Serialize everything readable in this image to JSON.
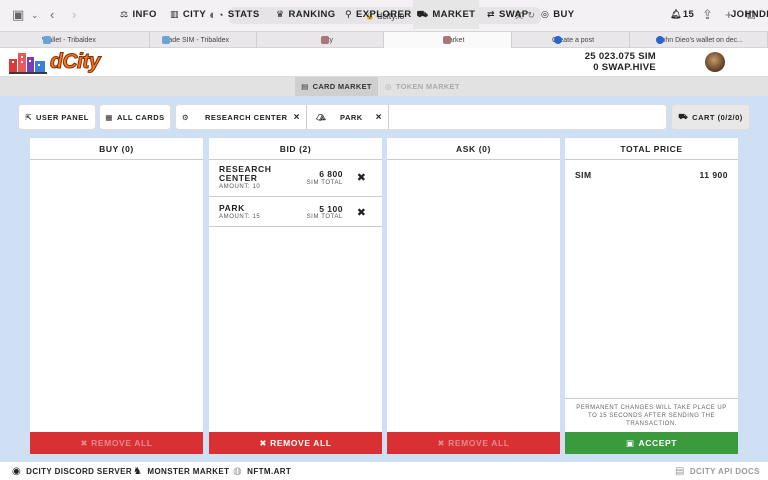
{
  "browser": {
    "url": "dcity.io",
    "tabs": [
      {
        "label": "Wallet - Tribaldex",
        "fav_color": "#6aa3d8"
      },
      {
        "label": "Trade SIM - Tribaldex",
        "fav_color": "#6aa3d8"
      },
      {
        "label": "City",
        "fav_color": "#a77"
      },
      {
        "label": "Market",
        "fav_color": "#a77"
      },
      {
        "label": "Create a post",
        "fav_color": "#2764d4"
      },
      {
        "label": "John Dieo's wallet on dec...",
        "fav_color": "#2764d4"
      }
    ]
  },
  "nav": {
    "logo": "dCity",
    "items": [
      {
        "label": "INFO",
        "icon": "balance-scale-icon"
      },
      {
        "label": "CITY",
        "icon": "city-icon"
      },
      {
        "label": "STATS",
        "icon": "chart-icon"
      },
      {
        "label": "RANKING",
        "icon": "trophy-icon"
      },
      {
        "label": "EXPLORER",
        "icon": "search-icon"
      },
      {
        "label": "MARKET",
        "icon": "cart-icon"
      },
      {
        "label": "SWAP",
        "icon": "swap-icon"
      },
      {
        "label": "BUY",
        "icon": "coins-icon"
      }
    ],
    "balance_sim": "25 023.075 SIM",
    "balance_hive": "0 SWAP.HIVE",
    "notifications": "15",
    "username": "JOHNDIE"
  },
  "subnav": {
    "card_market": "CARD MARKET",
    "token_market": "TOKEN MARKET"
  },
  "filters": {
    "user_panel": "USER PANEL",
    "all_cards": "ALL CARDS",
    "chip1": "RESEARCH CENTER",
    "chip2": "PARK",
    "cart": "CART (0/2/0)",
    "remove": "×"
  },
  "buy": {
    "title": "BUY (0)",
    "remove_all": "REMOVE ALL"
  },
  "bid": {
    "title": "BID (2)",
    "remove_all": "REMOVE ALL",
    "rows": [
      {
        "name": "RESEARCH CENTER",
        "amount": "AMOUNT: 10",
        "value": "6 800",
        "unit": "SIM TOTAL"
      },
      {
        "name": "PARK",
        "amount": "AMOUNT: 15",
        "value": "5 100",
        "unit": "SIM TOTAL"
      }
    ]
  },
  "ask": {
    "title": "ASK (0)",
    "remove_all": "REMOVE ALL"
  },
  "total": {
    "title": "TOTAL PRICE",
    "currency": "SIM",
    "value": "11 900",
    "notice": "PERMANENT CHANGES WILL TAKE PLACE UP TO 15 SECONDS AFTER SENDING THE TRANSACTION.",
    "accept": "ACCEPT"
  },
  "footer": {
    "discord": "DCITY DISCORD SERVER",
    "monster": "MONSTER MARKET",
    "nftm": "NFTM.ART",
    "api": "DCITY API DOCS"
  }
}
